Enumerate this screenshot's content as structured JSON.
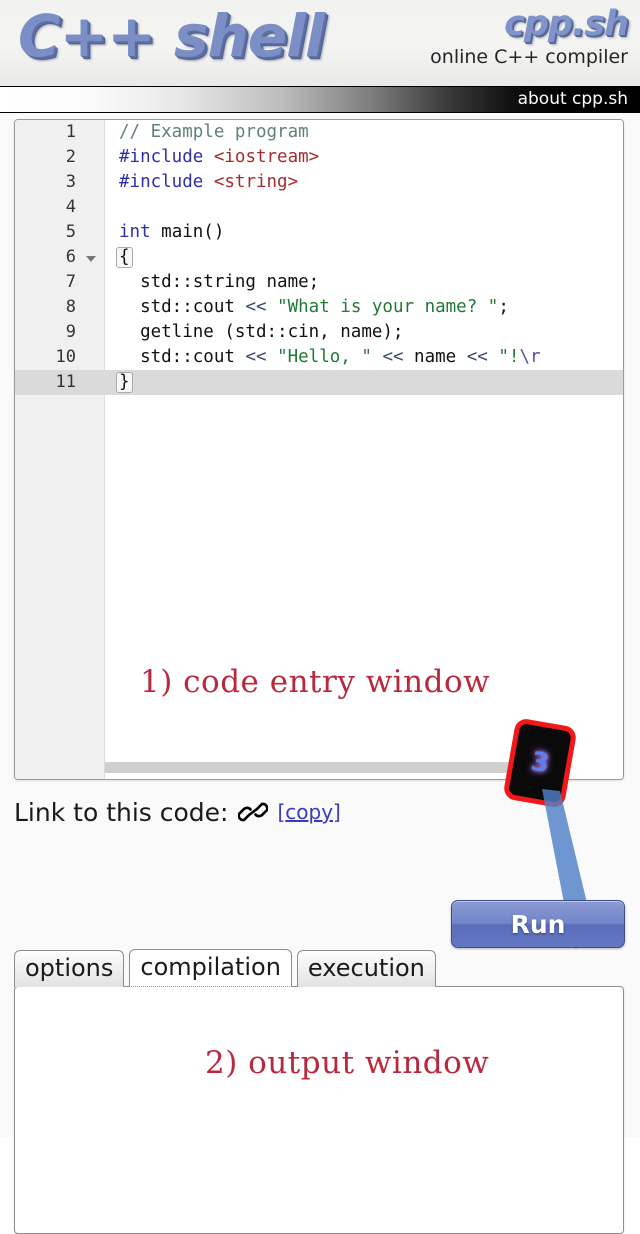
{
  "header": {
    "logo": "C++ shell",
    "brand_name": "cpp.sh",
    "brand_tagline": "online C++ compiler",
    "accent_color": "#7b8fc6"
  },
  "navbar": {
    "about_link": "about cpp.sh"
  },
  "editor": {
    "line_numbers": [
      "1",
      "2",
      "3",
      "4",
      "5",
      "6",
      "7",
      "8",
      "9",
      "10",
      "11"
    ],
    "active_line": "11",
    "fold_marker_line": "6",
    "lines": [
      {
        "n": "1",
        "text": "// Example program"
      },
      {
        "n": "2",
        "text": "#include <iostream>"
      },
      {
        "n": "3",
        "text": "#include <string>"
      },
      {
        "n": "4",
        "text": ""
      },
      {
        "n": "5",
        "text": "int main()"
      },
      {
        "n": "6",
        "text": "{"
      },
      {
        "n": "7",
        "text": "  std::string name;"
      },
      {
        "n": "8",
        "text": "  std::cout << \"What is your name? \";"
      },
      {
        "n": "9",
        "text": "  getline (std::cin, name);"
      },
      {
        "n": "10",
        "text": "  std::cout << \"Hello, \" << name << \"!\\n"
      },
      {
        "n": "11",
        "text": "}"
      }
    ],
    "syntax_colors": {
      "comment": "#5f8176",
      "preprocessor": "#2f2fa8",
      "header_name": "#a82b2b",
      "keyword": "#2f2fa8",
      "string": "#1f7a35",
      "operator": "#3c4a6e",
      "escape": "#5c4ea8"
    }
  },
  "annotations": {
    "one": "1) code entry window",
    "two": "2) output window",
    "badge": "3",
    "color": "#b9283c"
  },
  "link_row": {
    "label": "Link to this code:",
    "icon": "chain-link-icon",
    "copy_label_open": "[",
    "copy_label_text": "copy",
    "copy_label_close": "]"
  },
  "run": {
    "label": "Run",
    "color": "#6477c2"
  },
  "tabs": [
    {
      "label": "options",
      "active": false
    },
    {
      "label": "compilation",
      "active": true
    },
    {
      "label": "execution",
      "active": false
    }
  ],
  "output": {
    "content": ""
  }
}
